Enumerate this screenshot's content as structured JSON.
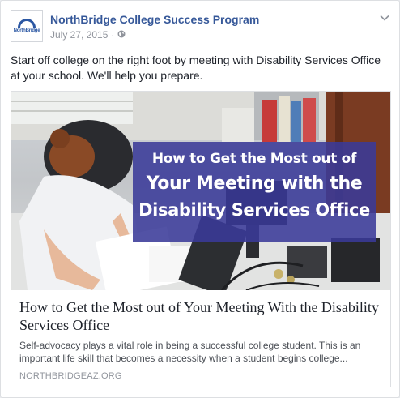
{
  "post": {
    "page_name": "NorthBridge College Success Program",
    "avatar_logo_text": "NorthBridge",
    "date": "July 27, 2015",
    "separator": "·",
    "privacy_icon": "globe-icon",
    "menu_icon": "chevron-down-icon",
    "message": "Start off college on the right foot by meeting with Disability Services Office at your school. We'll help you prepare."
  },
  "link": {
    "image_banner": {
      "line1": "How to Get the Most out of",
      "line2": "Your Meeting with the",
      "line3": "Disability Services Office"
    },
    "title": "How to Get the Most out of Your Meeting With the Disability Services Office",
    "description": "Self-advocacy plays a vital role in being a successful college student. This is an important life skill that becomes a necessity when a student begins college...",
    "domain": "NORTHBRIDGEAZ.ORG"
  },
  "colors": {
    "page_name": "#365899",
    "banner": "#3a3a98",
    "text": "#1d2129",
    "meta": "#90949c"
  }
}
